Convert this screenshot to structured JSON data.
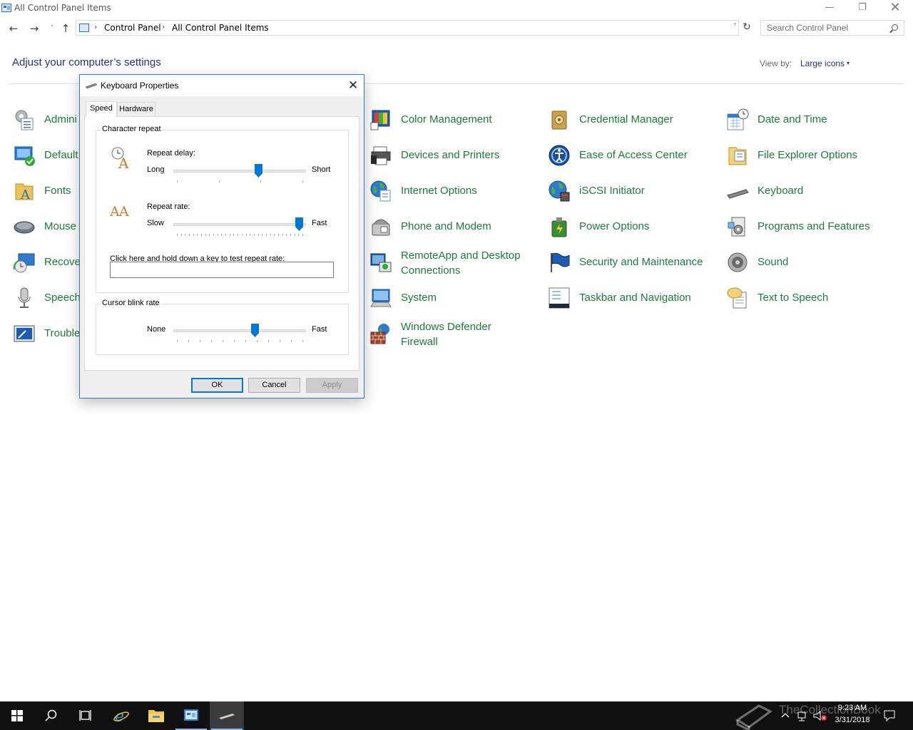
{
  "window": {
    "title": "All Control Panel Items",
    "minimize_glyph": "—",
    "maximize_glyph": "❐",
    "close_glyph": "✕"
  },
  "address_bar": {
    "back_glyph": "←",
    "forward_glyph": "→",
    "recent_glyph": "˅",
    "up_glyph": "↑",
    "separator": "›",
    "crumbs": [
      "Control Panel",
      "All Control Panel Items"
    ],
    "dropdown_glyph": "˅",
    "refresh_glyph": "↻",
    "search_placeholder": "Search Control Panel"
  },
  "header": {
    "title": "Adjust your computer’s settings",
    "view_by_label": "View by:",
    "view_by_value": "Large icons",
    "dropdown_glyph": "▾"
  },
  "items": [
    {
      "label": "Administrative Tools",
      "visible": "Admini",
      "icon": "admin-tools-icon"
    },
    {
      "label": "Default Programs",
      "visible": "Default",
      "icon": "default-programs-icon"
    },
    {
      "label": "Fonts",
      "visible": "Fonts",
      "icon": "fonts-icon"
    },
    {
      "label": "Mouse",
      "visible": "Mouse",
      "icon": "mouse-icon"
    },
    {
      "label": "Recovery",
      "visible": "Recove",
      "icon": "recovery-icon"
    },
    {
      "label": "Speech Recognition",
      "visible": "Speech",
      "icon": "microphone-icon"
    },
    {
      "label": "Troubleshooting",
      "visible": "Trouble",
      "icon": "troubleshooting-icon"
    },
    {
      "label": "Color Management",
      "icon": "color-management-icon"
    },
    {
      "label": "Devices and Printers",
      "icon": "printer-icon"
    },
    {
      "label": "Internet Options",
      "icon": "globe-icon"
    },
    {
      "label": "Phone and Modem",
      "icon": "phone-icon"
    },
    {
      "label": "RemoteApp and Desktop Connections",
      "line1": "RemoteApp and Desktop",
      "line2": "Connections",
      "icon": "remoteapp-icon"
    },
    {
      "label": "System",
      "icon": "system-icon"
    },
    {
      "label": "Windows Defender Firewall",
      "line1": "Windows Defender",
      "line2": "Firewall",
      "icon": "firewall-icon"
    },
    {
      "label": "Credential Manager",
      "icon": "credential-manager-icon"
    },
    {
      "label": "Ease of Access Center",
      "icon": "ease-of-access-icon"
    },
    {
      "label": "iSCSI Initiator",
      "icon": "iscsi-icon"
    },
    {
      "label": "Power Options",
      "icon": "power-options-icon"
    },
    {
      "label": "Security and Maintenance",
      "icon": "flag-icon"
    },
    {
      "label": "Taskbar and Navigation",
      "icon": "taskbar-icon"
    },
    {
      "label": "Date and Time",
      "icon": "calendar-clock-icon"
    },
    {
      "label": "File Explorer Options",
      "icon": "folder-options-icon"
    },
    {
      "label": "Keyboard",
      "icon": "keyboard-icon"
    },
    {
      "label": "Programs and Features",
      "icon": "programs-icon"
    },
    {
      "label": "Sound",
      "icon": "speaker-icon"
    },
    {
      "label": "Text to Speech",
      "icon": "speech-bubble-icon"
    }
  ],
  "dialog": {
    "title": "Keyboard Properties",
    "close_glyph": "✕",
    "tabs": [
      "Speed",
      "Hardware"
    ],
    "active_tab": "Speed",
    "character_repeat": {
      "group_title": "Character repeat",
      "repeat_delay_label": "Repeat delay:",
      "repeat_delay_min": "Long",
      "repeat_delay_max": "Short",
      "repeat_delay_position": 0.65,
      "repeat_delay_ticks": 4,
      "repeat_rate_label": "Repeat rate:",
      "repeat_rate_min": "Slow",
      "repeat_rate_max": "Fast",
      "repeat_rate_position": 0.97,
      "repeat_rate_ticks": 32,
      "test_label": "Click here and hold down a key to test repeat rate:",
      "test_value": ""
    },
    "cursor_blink": {
      "group_title": "Cursor blink rate",
      "min_label": "None",
      "max_label": "Fast",
      "position": 0.62,
      "ticks": 12
    },
    "buttons": {
      "ok": "OK",
      "cancel": "Cancel",
      "apply": "Apply"
    }
  },
  "taskbar": {
    "time": "9:23 AM",
    "date": "3/31/2018",
    "watermark": "TheCollectionBook"
  }
}
